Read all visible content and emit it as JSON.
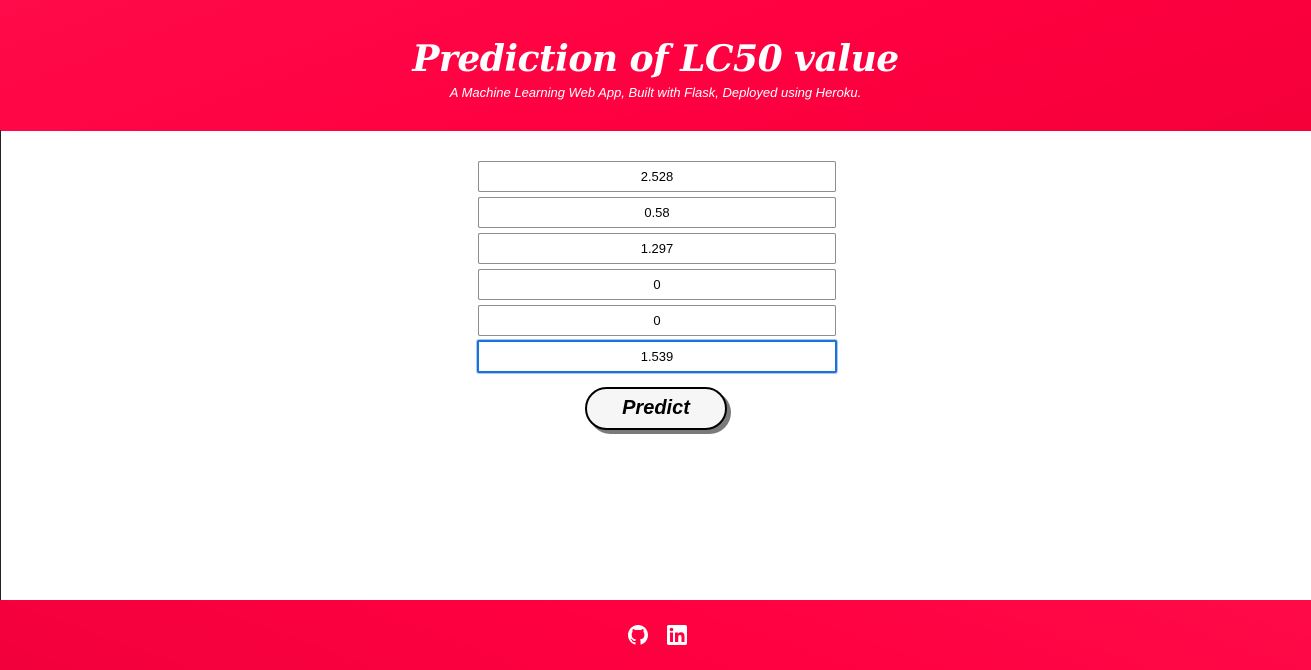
{
  "header": {
    "title": "Prediction of LC50 value",
    "subtitle": "A Machine Learning Web App, Built with Flask, Deployed using Heroku."
  },
  "form": {
    "fields": [
      {
        "value": "2.528"
      },
      {
        "value": "0.58"
      },
      {
        "value": "1.297"
      },
      {
        "value": "0"
      },
      {
        "value": "0"
      },
      {
        "value": "1.539"
      }
    ],
    "focused_field": "field-6",
    "predict_label": "Predict"
  },
  "footer": {
    "links": [
      {
        "icon": "github-icon"
      },
      {
        "icon": "linkedin-icon"
      }
    ]
  },
  "colors": {
    "header_bg": "#ff0040",
    "footer_bg": "#ff0040",
    "focus_ring": "#1a73d8"
  }
}
